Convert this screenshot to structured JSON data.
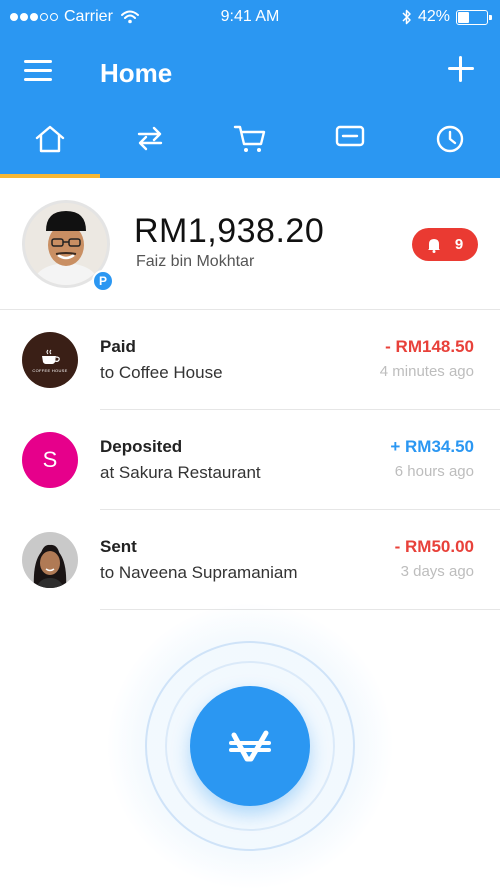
{
  "status_bar": {
    "carrier": "Carrier",
    "time": "9:41 AM",
    "battery": "42%",
    "battery_level": 0.42
  },
  "header": {
    "title": "Home",
    "menu_icon": "hamburger-menu-icon",
    "add_icon": "plus-icon"
  },
  "tabs": [
    {
      "icon": "home-icon",
      "active": true
    },
    {
      "icon": "transfer-arrows-icon",
      "active": false
    },
    {
      "icon": "shopping-cart-icon",
      "active": false
    },
    {
      "icon": "card-icon",
      "active": false
    },
    {
      "icon": "clock-icon",
      "active": false
    }
  ],
  "profile": {
    "balance": "RM1,938.20",
    "name": "Faiz bin Mokhtar",
    "badge": "P",
    "notification_count": "9"
  },
  "transactions": [
    {
      "type": "Paid",
      "party": "to Coffee House",
      "amount": "- RM148.50",
      "time": "4  minutes ago",
      "direction": "negative",
      "logo_text": "COFFEE HOUSE"
    },
    {
      "type": "Deposited",
      "party": "at Sakura Restaurant",
      "amount": "+ RM34.50",
      "time": "6 hours ago",
      "direction": "positive",
      "avatar_letter": "S"
    },
    {
      "type": "Sent",
      "party": "to Naveena Supramaniam",
      "amount": "- RM50.00",
      "time": "3 days ago",
      "direction": "negative"
    }
  ],
  "colors": {
    "primary": "#2b97f2",
    "accent": "#f7b733",
    "negative": "#e8413a",
    "notification": "#ea3a32"
  },
  "fab": {
    "icon": "currency-logo-icon"
  }
}
